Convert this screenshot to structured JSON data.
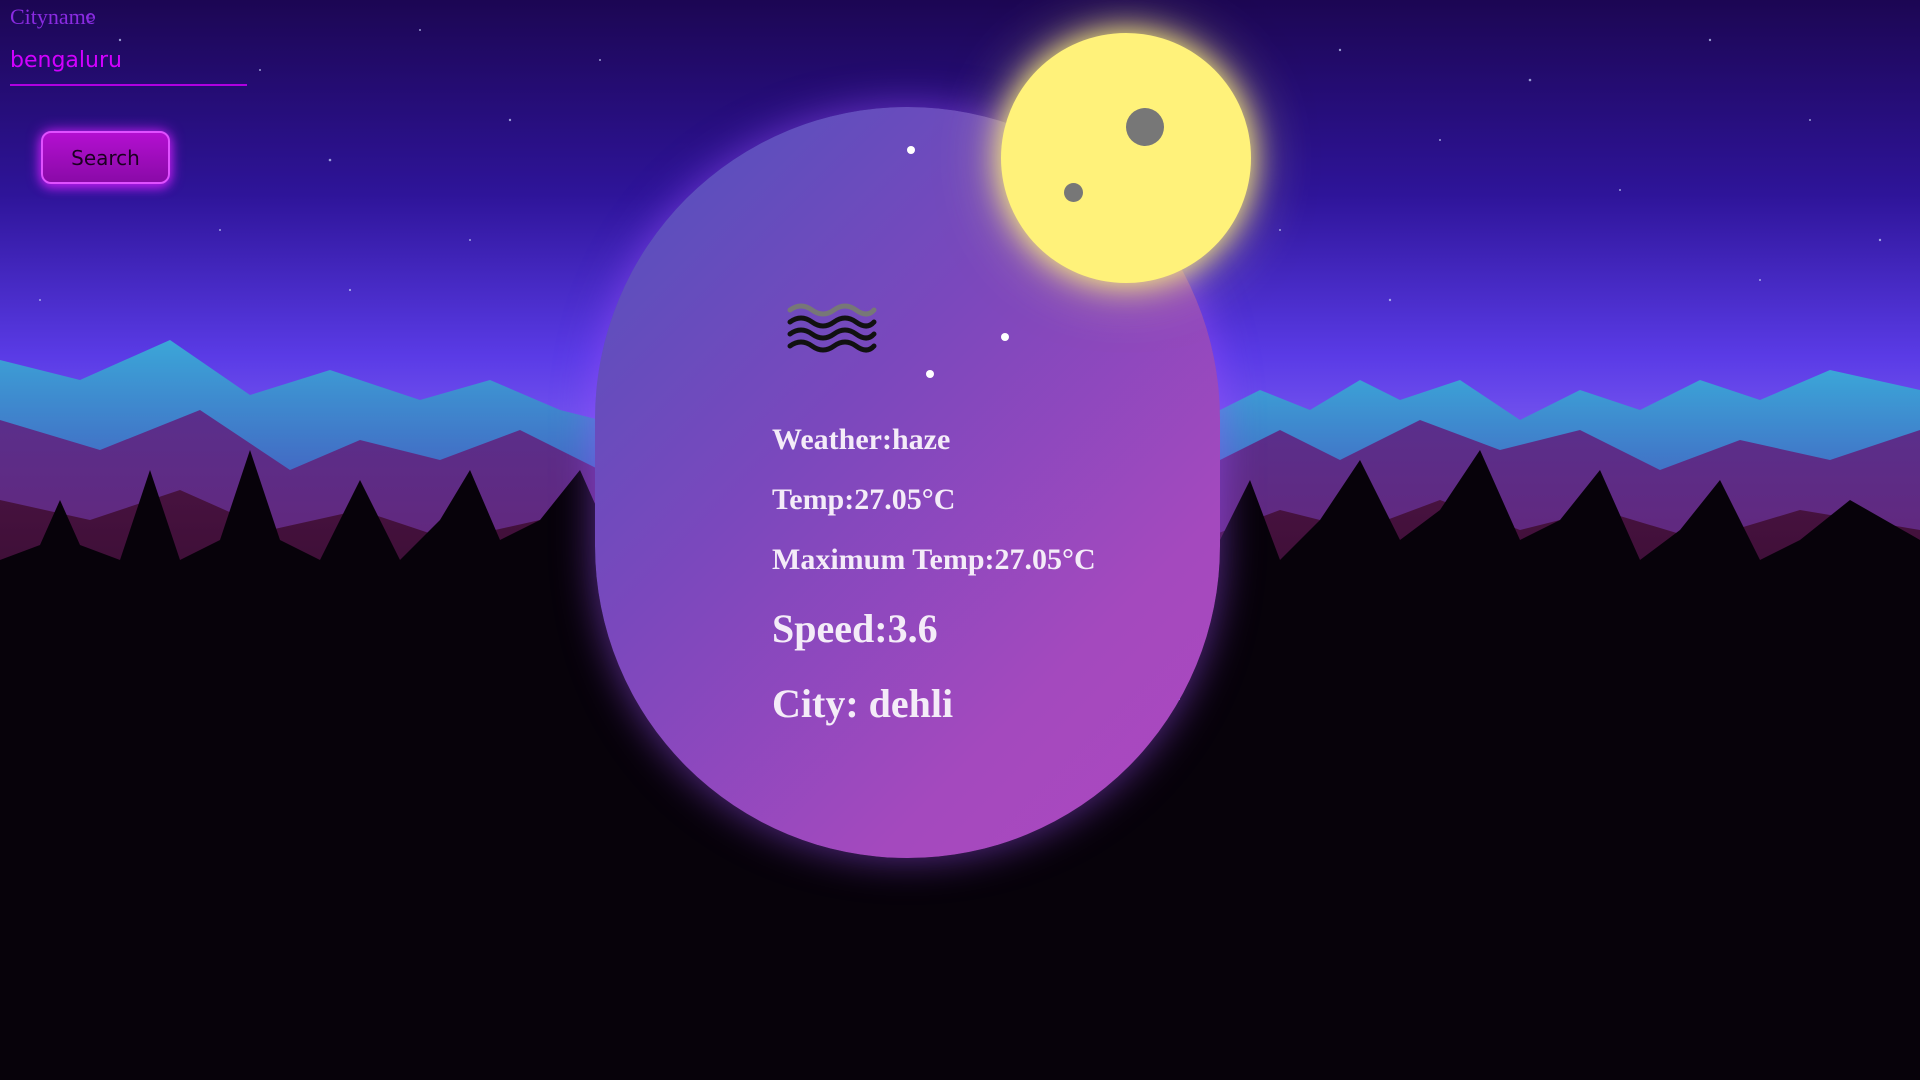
{
  "search": {
    "label": "Cityname",
    "value": "bengaluru"
  },
  "button": {
    "label": "Search"
  },
  "weather": {
    "icon": "haze-icon",
    "weather_text": "Weather:haze",
    "temp_text": "Temp:27.05°C",
    "max_temp_text": "Maximum Temp:27.05°C",
    "speed_text": "Speed:3.6",
    "city_text": "City: dehli"
  },
  "colors": {
    "accent": "#b000e0",
    "moon": "#fff27a",
    "card_start": "#4f52bd",
    "card_end": "#ad48c0"
  }
}
